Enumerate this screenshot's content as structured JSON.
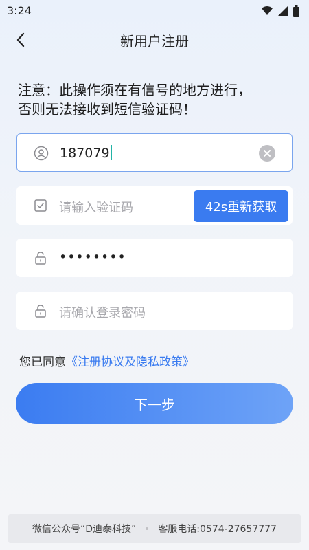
{
  "status_bar": {
    "time": "3:24"
  },
  "nav": {
    "title": "新用户注册"
  },
  "notice": {
    "line1": "注意：此操作须在有信号的地方进行，",
    "line2": "否则无法接收到短信验证码！"
  },
  "phone_field": {
    "value": "187079"
  },
  "code_field": {
    "placeholder": "请输入验证码",
    "resend_label": "42s重新获取"
  },
  "password_field": {
    "value": "••••••••"
  },
  "confirm_field": {
    "placeholder": "请确认登录密码"
  },
  "agreement": {
    "prefix": "您已同意",
    "link": "《注册协议及隐私政策》"
  },
  "next_button": {
    "label": "下一步"
  },
  "footer": {
    "wechat": "微信公众号“D迪泰科技”",
    "hotline": "客服电话:0574-27657777"
  },
  "colors": {
    "accent": "#3a7bf0",
    "focus_border": "#7aa5ee",
    "cursor": "#23b3a6"
  }
}
